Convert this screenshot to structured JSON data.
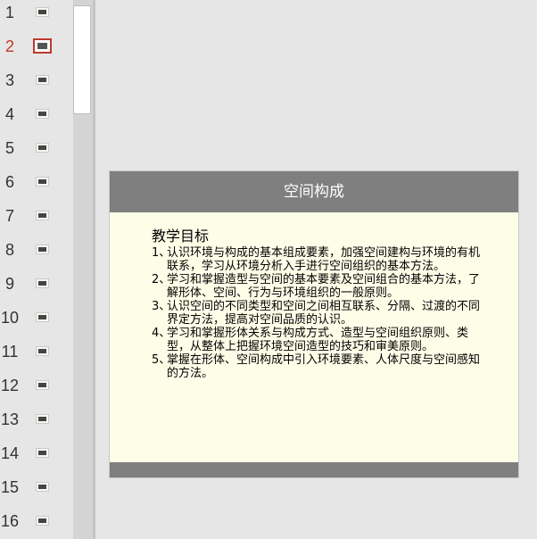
{
  "thumbnails": [
    {
      "number": "1",
      "active": false
    },
    {
      "number": "2",
      "active": true
    },
    {
      "number": "3",
      "active": false
    },
    {
      "number": "4",
      "active": false
    },
    {
      "number": "5",
      "active": false
    },
    {
      "number": "6",
      "active": false
    },
    {
      "number": "7",
      "active": false
    },
    {
      "number": "8",
      "active": false
    },
    {
      "number": "9",
      "active": false
    },
    {
      "number": "10",
      "active": false
    },
    {
      "number": "11",
      "active": false
    },
    {
      "number": "12",
      "active": false
    },
    {
      "number": "13",
      "active": false
    },
    {
      "number": "14",
      "active": false
    },
    {
      "number": "15",
      "active": false
    },
    {
      "number": "16",
      "active": false
    }
  ],
  "slide": {
    "title": "空间构成",
    "heading": "教学目标",
    "objectives": [
      {
        "num": "1、",
        "text": "认识环境与构成的基本组成要素，加强空间建构与环境的有机联系，学习从环境分析入手进行空间组织的基本方法。"
      },
      {
        "num": "2、",
        "text": "学习和掌握造型与空间的基本要素及空间组合的基本方法，了解形体、空间、行为与环境组织的一般原则。"
      },
      {
        "num": "3、",
        "text": "认识空间的不同类型和空间之间相互联系、分隔、过渡的不同界定方法，提高对空间品质的认识。"
      },
      {
        "num": "4、",
        "text": "学习和掌握形体关系与构成方式、造型与空间组织原则、类型，从整体上把握环境空间造型的技巧和审美原则。"
      },
      {
        "num": "5、",
        "text": "掌握在形体、空间构成中引入环境要素、人体尺度与空间感知的方法。"
      }
    ]
  },
  "colors": {
    "active_accent": "#c0392b",
    "slide_bar": "#7f7f7f",
    "slide_bg": "#fefee8"
  }
}
